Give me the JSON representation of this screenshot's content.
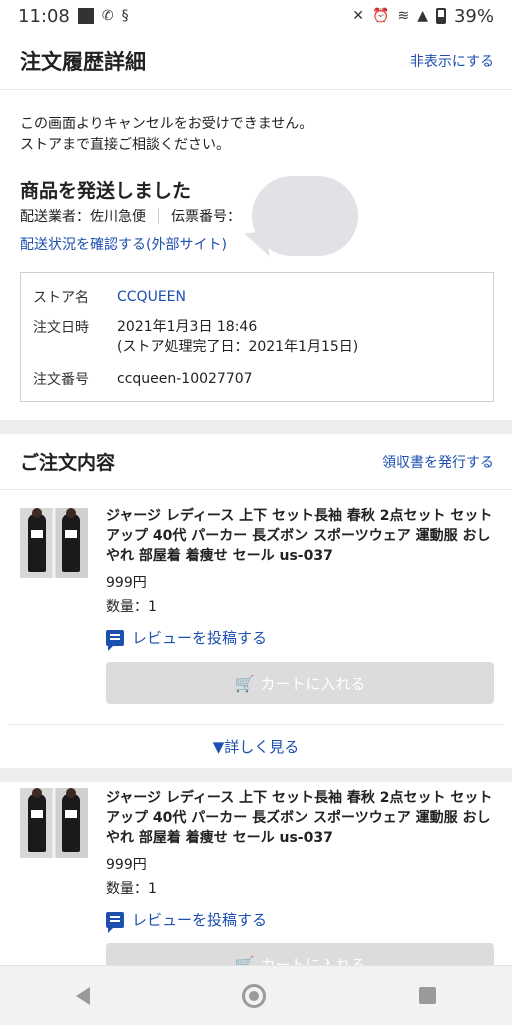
{
  "status_bar": {
    "time": "11:08",
    "battery": "39%"
  },
  "header": {
    "title": "注文履歴詳細",
    "hide_link": "非表示にする"
  },
  "notice": {
    "line1": "この画面よりキャンセルをお受けできません。",
    "line2": "ストアまで直接ご相談ください。"
  },
  "shipping": {
    "title": "商品を発送しました",
    "carrier_label": "配送業者：",
    "carrier": "佐川急便",
    "tracking_label": "伝票番号：",
    "track_link": "配送状況を確認する(外部サイト)"
  },
  "order_info": {
    "store_label": "ストア名",
    "store": "CCQUEEN",
    "date_label": "注文日時",
    "date": "2021年1月3日 18:46",
    "date_note": "(ストア処理完了日：2021年1月15日)",
    "number_label": "注文番号",
    "number": "ccqueen-10027707"
  },
  "contents": {
    "title": "ご注文内容",
    "receipt_link": "領収書を発行する"
  },
  "items": [
    {
      "title": "ジャージ レディース 上下 セット長袖 春秋 2点セット セットアップ 40代 パーカー 長ズボン スポーツウェア 運動服 おしやれ 部屋着 着痩せ セール us-037",
      "price": "999円",
      "quantity": "数量：1",
      "review": "レビューを投稿する",
      "cart": "カートに入れる"
    },
    {
      "title": "ジャージ レディース 上下 セット長袖 春秋 2点セット セットアップ 40代 パーカー 長ズボン スポーツウェア 運動服 おしやれ 部屋着 着痩せ セール us-037",
      "price": "999円",
      "quantity": "数量：1",
      "review": "レビューを投稿する",
      "cart": "カートに入れる"
    }
  ],
  "more_link": "▼詳しく見る",
  "colors": {
    "link": "#1d4fb0",
    "disabled_button": "#dcdcdc",
    "section_gap": "#eeeeee"
  }
}
